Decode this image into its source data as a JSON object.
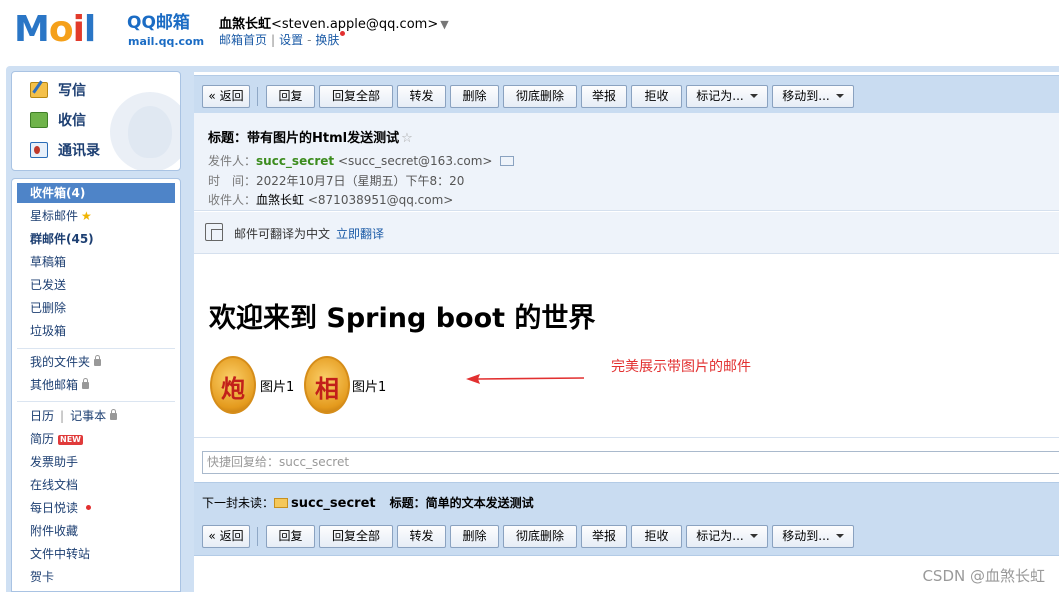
{
  "header": {
    "logo_text_m": "M",
    "logo_text_o": "o",
    "logo_text_i": "i",
    "logo_text_l": "l",
    "logo_title": "QQ邮箱",
    "logo_url": "mail.qq.com",
    "user_name": "血煞长虹",
    "user_email": "<steven.apple@qq.com>",
    "user_caret": "▼",
    "links": {
      "home": "邮箱首页",
      "sep": "|",
      "settings": "设置",
      "dash": "-",
      "skin": "换肤"
    }
  },
  "sidebar": {
    "commands": {
      "write": "写信",
      "receive": "收信",
      "contacts": "通讯录"
    },
    "folders": {
      "inbox": "收件箱(4)",
      "starred": "星标邮件",
      "star_glyph": "★",
      "group": "群邮件(45)",
      "drafts": "草稿箱",
      "sent": "已发送",
      "deleted": "已删除",
      "spam": "垃圾箱",
      "my_folders": "我的文件夹",
      "other_mail": "其他邮箱",
      "calendar": "日历",
      "bar": "|",
      "notes": "记事本",
      "resume": "简历",
      "new_badge": "NEW",
      "invoice": "发票助手",
      "online_docs": "在线文档",
      "daily_reading": "每日悦读",
      "attachments": "附件收藏",
      "transfer": "文件中转站",
      "cards": "贺卡"
    }
  },
  "toolbar": {
    "back": "« 返回",
    "reply": "回复",
    "reply_all": "回复全部",
    "forward": "转发",
    "delete": "删除",
    "delete_perm": "彻底删除",
    "report": "举报",
    "reject": "拒收",
    "mark_as": "标记为...",
    "move_to": "移动到..."
  },
  "mail": {
    "subject_label": "标题：",
    "subject": "带有图片的Html发送测试",
    "star": "☆",
    "from_label": "发件人：",
    "from_name": "succ_secret",
    "from_email": "<succ_secret@163.com>",
    "time_label": "时　间：",
    "time": "2022年10月7日（星期五）下午8：20",
    "to_label": "收件人：",
    "to_name": "血煞长虹",
    "to_email": "<871038951@qq.com>"
  },
  "translate": {
    "text": "邮件可翻译为中文",
    "link": "立即翻译"
  },
  "body": {
    "heading": "欢迎来到 Spring boot 的世界",
    "images": [
      {
        "glyph": "炮",
        "label": "图片1"
      },
      {
        "glyph": "相",
        "label": "图片1"
      }
    ],
    "annotation": "完美展示带图片的邮件",
    "annotation_color": "#e23030"
  },
  "quick_reply": {
    "placeholder": "快捷回复给：succ_secret"
  },
  "next_unread": {
    "label": "下一封未读：",
    "from": "succ_secret",
    "subject_label": "标题：",
    "subject": "简单的文本发送测试"
  },
  "watermark": "CSDN @血煞长虹",
  "colors": {
    "accent": "#4e84c8",
    "toolbar": "#c9dcf1",
    "link": "#1a5aa6",
    "sender": "#3c8c1e"
  }
}
